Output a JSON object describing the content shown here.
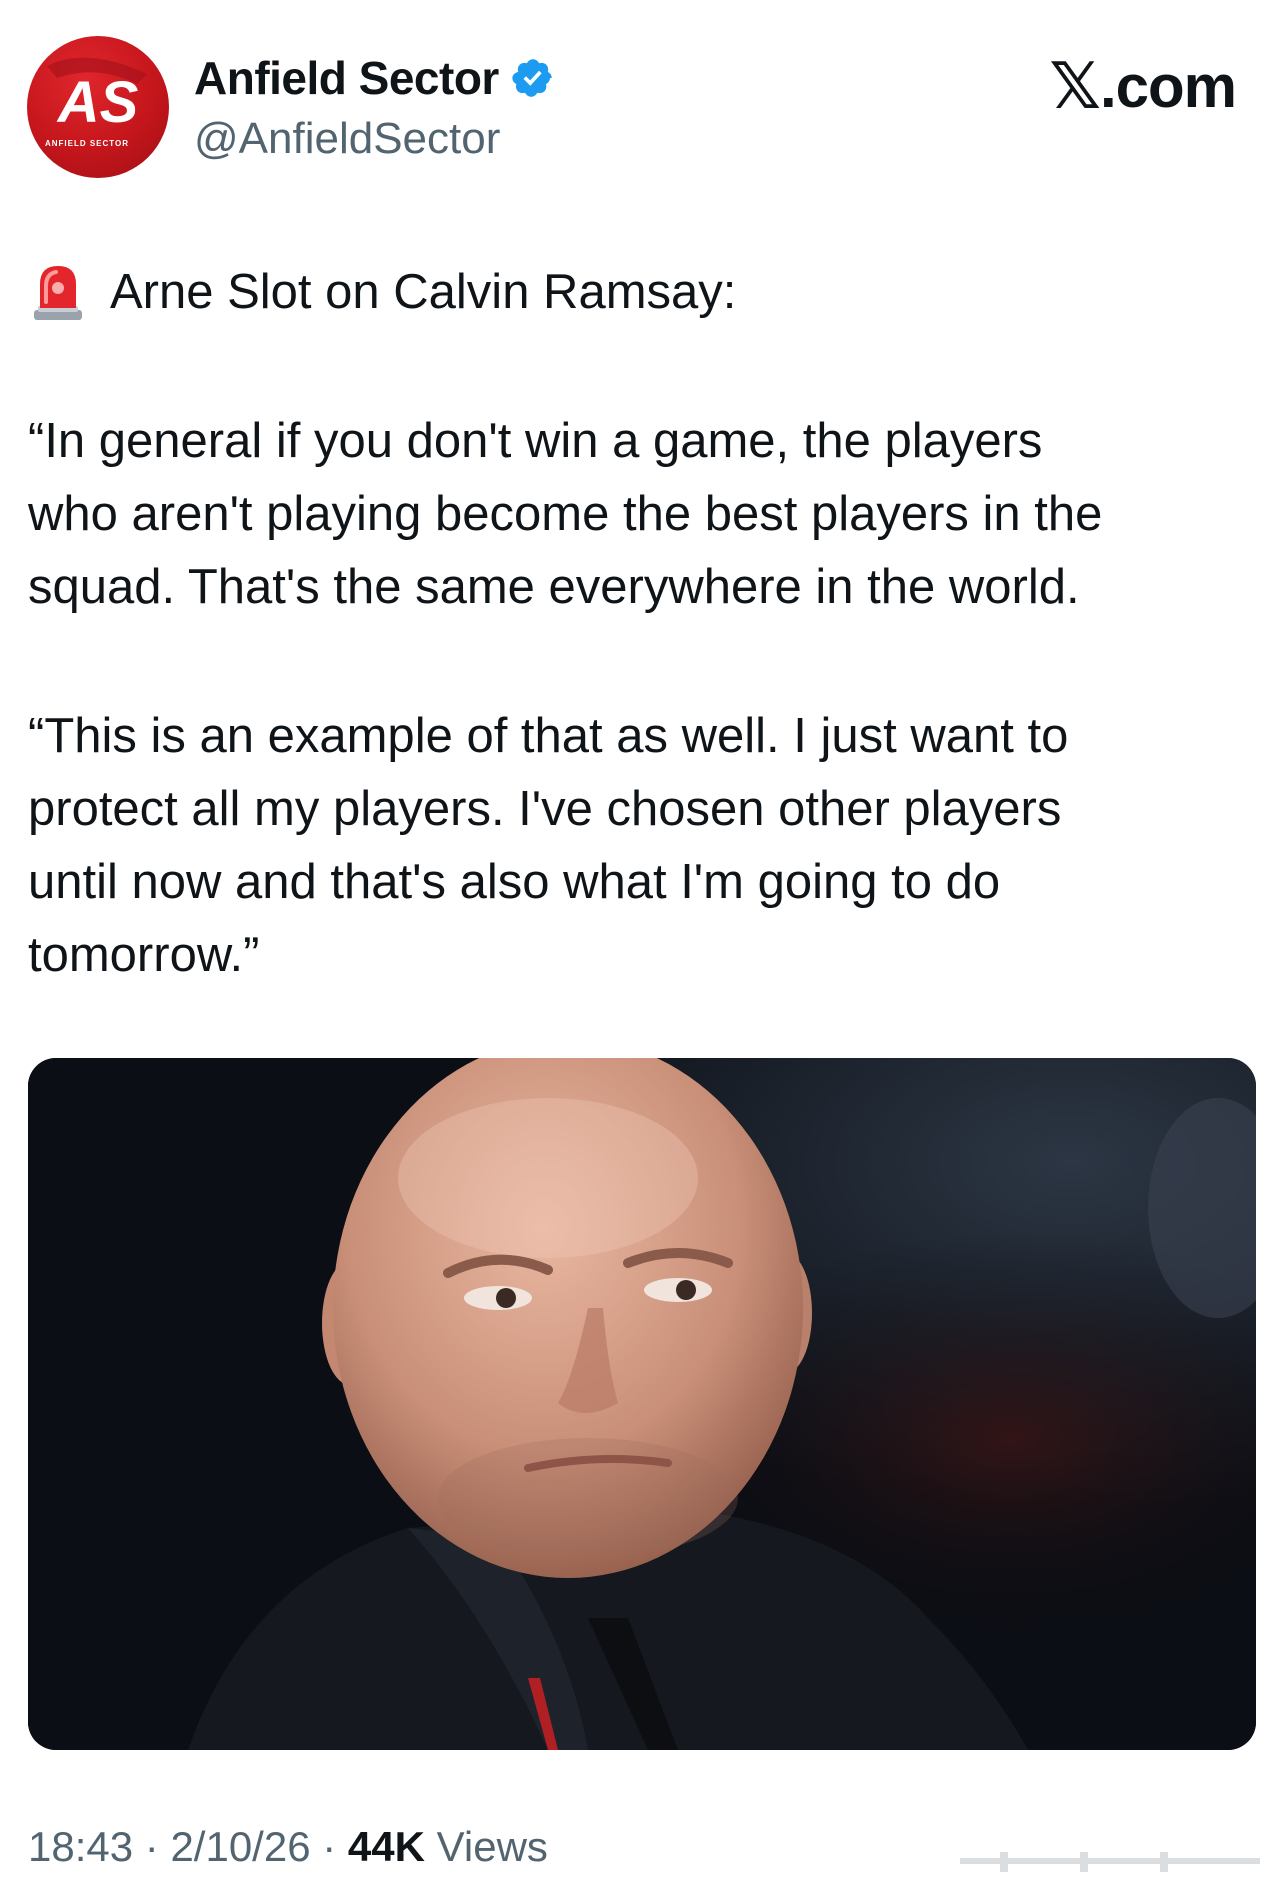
{
  "author": {
    "display_name": "Anfield Sector",
    "handle": "@AnfieldSector",
    "verified": true,
    "avatar": {
      "monogram": "AS",
      "caption": "ANFIELD SECTOR",
      "bg_color": "#c4161c"
    }
  },
  "brand": {
    "x_glyph": "𝕏",
    "suffix": ".com"
  },
  "tweet": {
    "headline_icon": "siren-icon",
    "headline": "Arne Slot on Calvin Ramsay:",
    "paragraph_1": "“In general if you don't win a game, the players\nwho aren't playing become the best players in the\nsquad. That's the same everywhere in the world.",
    "paragraph_2": "“This is an example of that as well. I just want to\nprotect all my players. I've chosen other players\nuntil now and that's also what I'm going to do\ntomorrow.”"
  },
  "meta": {
    "time": "18:43",
    "separator": " · ",
    "date": "2/10/26",
    "views_count": "44K",
    "views_label": " Views"
  },
  "colors": {
    "text_primary": "#0f1419",
    "text_secondary": "#536471",
    "verified_blue": "#1d9bf0"
  }
}
